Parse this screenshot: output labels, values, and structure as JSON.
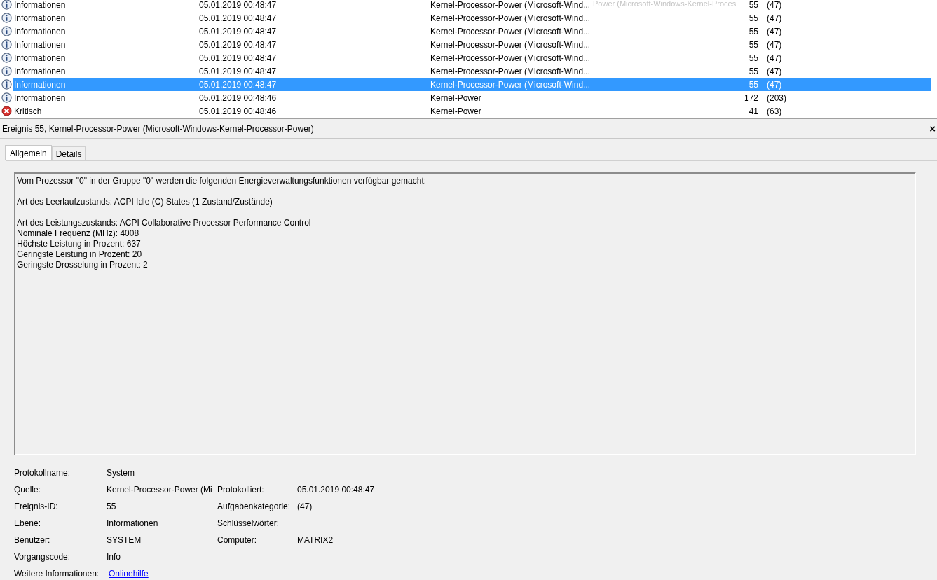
{
  "events": {
    "rows": [
      {
        "kind": "info",
        "level": "Informationen",
        "date": "05.01.2019 00:48:47",
        "source": "Kernel-Processor-Power (Microsoft-Wind...",
        "id": "55",
        "category": "(47)",
        "selected": false
      },
      {
        "kind": "info",
        "level": "Informationen",
        "date": "05.01.2019 00:48:47",
        "source": "Kernel-Processor-Power (Microsoft-Wind...",
        "id": "55",
        "category": "(47)",
        "selected": false
      },
      {
        "kind": "info",
        "level": "Informationen",
        "date": "05.01.2019 00:48:47",
        "source": "Kernel-Processor-Power (Microsoft-Wind...",
        "id": "55",
        "category": "(47)",
        "selected": false
      },
      {
        "kind": "info",
        "level": "Informationen",
        "date": "05.01.2019 00:48:47",
        "source": "Kernel-Processor-Power (Microsoft-Wind...",
        "id": "55",
        "category": "(47)",
        "selected": false
      },
      {
        "kind": "info",
        "level": "Informationen",
        "date": "05.01.2019 00:48:47",
        "source": "Kernel-Processor-Power (Microsoft-Wind...",
        "id": "55",
        "category": "(47)",
        "selected": false
      },
      {
        "kind": "info",
        "level": "Informationen",
        "date": "05.01.2019 00:48:47",
        "source": "Kernel-Processor-Power (Microsoft-Wind...",
        "id": "55",
        "category": "(47)",
        "selected": false
      },
      {
        "kind": "info",
        "level": "Informationen",
        "date": "05.01.2019 00:48:47",
        "source": "Kernel-Processor-Power (Microsoft-Wind...",
        "id": "55",
        "category": "(47)",
        "selected": true
      },
      {
        "kind": "info",
        "level": "Informationen",
        "date": "05.01.2019 00:48:46",
        "source": "Kernel-Power",
        "id": "172",
        "category": "(203)",
        "selected": false
      },
      {
        "kind": "critical",
        "level": "Kritisch",
        "date": "05.01.2019 00:48:46",
        "source": "Kernel-Power",
        "id": "41",
        "category": "(63)",
        "selected": false
      }
    ],
    "tooltip": "Power (Microsoft-Windows-Kernel-Proces"
  },
  "detail": {
    "title": "Ereignis 55, Kernel-Processor-Power (Microsoft-Windows-Kernel-Processor-Power)",
    "close": "×",
    "tabs": [
      {
        "label": "Allgemein",
        "selected": true
      },
      {
        "label": "Details",
        "selected": false
      }
    ],
    "message": [
      [
        "Vom Prozessor \"0\" in der Gruppe \"0\" werden die folgenden Energieverwaltungsfunktionen verfügbar gemacht:"
      ],
      [
        "Art des Leerlaufzustands: ACPI Idle (C) States (1 Zustand/Zustände)"
      ],
      [
        "Art des Leistungszustands: ACPI Collaborative Processor Performance Control",
        "Nominale Frequenz (MHz): 4008",
        "Höchste Leistung in Prozent: 637",
        "Geringste Leistung in Prozent: 20",
        "Geringste Drosselung in Prozent: 2"
      ]
    ],
    "fields": [
      {
        "label": "Protokollname:",
        "value": "System"
      },
      {
        "label": "Quelle:",
        "value": "Kernel-Processor-Power (Mi",
        "label2": "Protokolliert:",
        "value2": "05.01.2019 00:48:47"
      },
      {
        "label": "Ereignis-ID:",
        "value": "55",
        "label2": "Aufgabenkategorie:",
        "value2": "(47)"
      },
      {
        "label": "Ebene:",
        "value": "Informationen",
        "label2": "Schlüsselwörter:"
      },
      {
        "label": "Benutzer:",
        "value": "SYSTEM",
        "label2": "Computer:",
        "value2": "MATRIX2"
      },
      {
        "label": "Vorgangscode:",
        "value": "Info"
      },
      {
        "label": "Weitere Informationen:",
        "link": "Onlinehilfe"
      }
    ]
  }
}
